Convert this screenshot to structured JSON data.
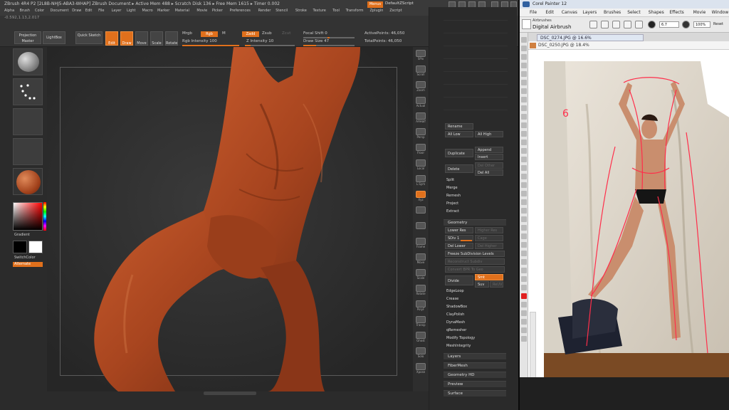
{
  "zbrush": {
    "title_line1": "ZBrush 4R4 P2  [2L8B-NHJ5-ABA3-WHAP]   ZBrush Document     ▸ Active Mem 488  ▸ Scratch Disk 136  ▸ Free Mem 1615  ▸ Timer 0.002",
    "menus_label": "Menus",
    "default_script": "DefaultZScript",
    "menu_items": [
      "Alpha",
      "Brush",
      "Color",
      "Document",
      "Draw",
      "Edit",
      "File",
      "Layer",
      "Light",
      "Macro",
      "Marker",
      "Material",
      "Movie",
      "Picker",
      "Preferences",
      "Render",
      "Stencil",
      "Stroke",
      "Texture",
      "Tool",
      "Transform",
      "Zplugin",
      "Zscript"
    ],
    "coords": "-0.592,1.13,2.017",
    "toolbar": {
      "projection_master": "Projection Master",
      "lightbox": "LightBox",
      "quick_sketch": "Quick Sketch",
      "edit": "Edit",
      "draw": "Draw",
      "move": "Move",
      "scale": "Scale",
      "rotate": "Rotate",
      "mrgb": "Mrgb",
      "rgb": "Rgb",
      "m": "M",
      "rgb_intensity": "Rgb Intensity 100",
      "zadd": "Zadd",
      "zsub": "Zsub",
      "zcut": "Zcut",
      "z_intensity": "Z Intensity 10",
      "focal_shift": "Focal Shift 0",
      "draw_size": "Draw Size 47",
      "active_points": "ActivePoints: 46,050",
      "total_points": "TotalPoints: 46,050"
    },
    "left_shelf": {
      "gradient": "Gradient",
      "switch_color": "SwitchColor",
      "alternate": "Alternate"
    },
    "right_shelf": [
      "SPix",
      "Scroll",
      "Zoom",
      "Actual",
      "AAHalf",
      "Persp",
      "Floor",
      "Local",
      "L.Sym",
      "Xyz",
      "",
      "",
      "Frame",
      "Move",
      "Scale",
      "Rotate",
      "PolyF",
      "Transp",
      "Ghost",
      "Solo",
      "Xpose"
    ],
    "palette": {
      "rename": "Rename",
      "all_low": "All Low",
      "all_high": "All High",
      "duplicate": "Duplicate",
      "append": "Append",
      "insert": "Insert",
      "delete": "Delete",
      "del_other": "Del Other",
      "del_all": "Del All",
      "split": "Split",
      "merge": "Merge",
      "remesh": "Remesh",
      "project": "Project",
      "extract": "Extract",
      "geometry": "Geometry",
      "lower_res": "Lower Res",
      "higher_res": "Higher Res",
      "sdiv": "SDiv 1",
      "cage": "Cage",
      "rstr": "Rstr",
      "del_lower": "Del Lower",
      "del_higher": "Del Higher",
      "freeze_sub": "Freeze SubDivision Levels",
      "reconstruct": "Reconstruct Subdiv",
      "convert_bpr": "Convert BPR To Geo",
      "divide": "Divide",
      "smt": "Smt",
      "suv": "Suv",
      "reuv": "ReUV",
      "edgeloop": "EdgeLoop",
      "crease": "Crease",
      "shadowbox": "ShadowBox",
      "claypolish": "ClayPolish",
      "dynamesh": "DynaMesh",
      "qremesher": "qRemesher",
      "modify_topology": "Modify Topology",
      "meshintegrity": "MeshIntegrity",
      "layers": "Layers",
      "fibermesh": "FiberMesh",
      "geometry_hd": "Geometry HD",
      "preview": "Preview",
      "surface": "Surface"
    }
  },
  "painter": {
    "title": "Corel Painter 12",
    "menus": [
      "File",
      "Edit",
      "Canvas",
      "Layers",
      "Brushes",
      "Select",
      "Shapes",
      "Effects",
      "Movie",
      "Window",
      "Help"
    ],
    "brush_category": "Airbrushes",
    "brush_variant": "Digital Airbrush",
    "size_value": "6.7",
    "opacity_value": "100%",
    "reset_label": "Reset",
    "doc_tab": "DSC_0274.JPG @ 16.6%",
    "doc_title": "DSC_0250.JPG @ 18.4%"
  },
  "colors": {
    "accent": "#e0701c",
    "sculpt": "#a8451f",
    "canvas_bg": "#2e2e2e"
  }
}
